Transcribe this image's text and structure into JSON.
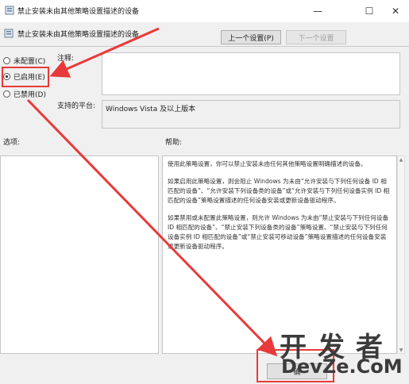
{
  "window": {
    "title": "禁止安装未由其他策略设置描述的设备",
    "min_glyph": "—",
    "max_glyph": "☐",
    "close_glyph": "✕"
  },
  "header": {
    "policy_name": "禁止安装未由其他策略设置描述的设备",
    "prev_label": "上一个设置(P)",
    "next_label": "下一个设置"
  },
  "state": {
    "options": [
      {
        "label": "未配置(C)",
        "checked": false
      },
      {
        "label": "已启用(E)",
        "checked": true
      },
      {
        "label": "已禁用(D)",
        "checked": false
      }
    ]
  },
  "comment": {
    "label": "注释:",
    "value": ""
  },
  "supported": {
    "label": "支持的平台:",
    "value": "Windows Vista 及以上版本"
  },
  "options_pane": {
    "label": "选项:"
  },
  "help": {
    "label": "帮助:",
    "paragraphs": [
      "使用此策略设置，你可以禁止安装未由任何其他策略设置明确描述的设备。",
      "如果启用此策略设置，则会阻止 Windows 为未由“允许安装与下列任何设备 ID 相匹配的设备”、“允许安装下列设备类的设备”或“允许安装与下列任何设备实例 ID 相匹配的设备”策略设置描述的任何设备安装或更新设备驱动程序。",
      "如果禁用或未配置此策略设置，则允许 Windows 为未由“禁止安装与下列任何设备 ID 相匹配的设备”、“禁止安装下列设备类的设备”策略设置、“禁止安装与下列任何设备实例 ID 相匹配的设备”或“禁止安装可移动设备”策略设置描述的任何设备安装或更新设备驱动程序。"
    ]
  },
  "footer": {
    "ok_label": "确"
  },
  "watermark": {
    "cn": "开发者",
    "en": "DevZe.CoM"
  },
  "colors": {
    "annotation": "#e83a3a"
  }
}
